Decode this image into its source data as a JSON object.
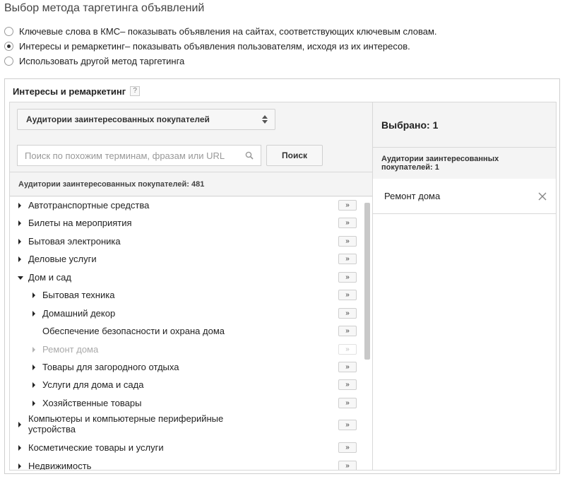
{
  "page": {
    "title": "Выбор метода таргетинга объявлений"
  },
  "targeting_options": [
    {
      "bold": "Ключевые слова в КМС",
      "desc": " – показывать объявления на сайтах, соответствующих ключевым словам.",
      "checked": false
    },
    {
      "bold": "Интересы и ремаркетинг",
      "desc": " – показывать объявления пользователям, исходя из их интересов.",
      "checked": true
    },
    {
      "bold": "Использовать другой метод таргетинга",
      "desc": "",
      "checked": false
    }
  ],
  "panel": {
    "title": "Интересы и ремаркетинг",
    "help_icon": "?"
  },
  "left": {
    "select_value": "Аудитории заинтересованных покупателей",
    "search_placeholder": "Поиск по похожим терминам, фразам или URL",
    "search_button": "Поиск",
    "list_header": "Аудитории заинтересованных покупателей: 481",
    "add_button_label": "»",
    "items": [
      {
        "label": "Автотранспортные средства",
        "level": 0,
        "arrow": "right",
        "disabled": false
      },
      {
        "label": "Билеты на мероприятия",
        "level": 0,
        "arrow": "right",
        "disabled": false
      },
      {
        "label": "Бытовая электроника",
        "level": 0,
        "arrow": "right",
        "disabled": false
      },
      {
        "label": "Деловые услуги",
        "level": 0,
        "arrow": "right",
        "disabled": false
      },
      {
        "label": "Дом и сад",
        "level": 0,
        "arrow": "down",
        "disabled": false
      },
      {
        "label": "Бытовая техника",
        "level": 1,
        "arrow": "right",
        "disabled": false
      },
      {
        "label": "Домашний декор",
        "level": 1,
        "arrow": "right",
        "disabled": false
      },
      {
        "label": "Обеспечение безопасности и охрана дома",
        "level": 1,
        "arrow": "none",
        "disabled": false
      },
      {
        "label": "Ремонт дома",
        "level": 1,
        "arrow": "right",
        "disabled": true
      },
      {
        "label": "Товары для загородного отдыха",
        "level": 1,
        "arrow": "right",
        "disabled": false
      },
      {
        "label": "Услуги для дома и сада",
        "level": 1,
        "arrow": "right",
        "disabled": false
      },
      {
        "label": "Хозяйственные товары",
        "level": 1,
        "arrow": "right",
        "disabled": false
      },
      {
        "label": "Компьютеры и компьютерные периферийные устройства",
        "level": 0,
        "arrow": "right",
        "disabled": false
      },
      {
        "label": "Косметические товары и услуги",
        "level": 0,
        "arrow": "right",
        "disabled": false
      },
      {
        "label": "Недвижимость",
        "level": 0,
        "arrow": "right",
        "disabled": false
      }
    ]
  },
  "right": {
    "selected_header": "Выбрано: 1",
    "group_label": "Аудитории заинтересованных покупателей: 1",
    "selected_item": "Ремонт дома"
  },
  "colors": {
    "panel_bg": "#f4f4f4",
    "border": "#d8d8d8",
    "disabled_text": "#aaaaaa"
  },
  "icons": {
    "select": "updown-arrows-icon",
    "search": "search-icon",
    "remove": "close-icon"
  }
}
